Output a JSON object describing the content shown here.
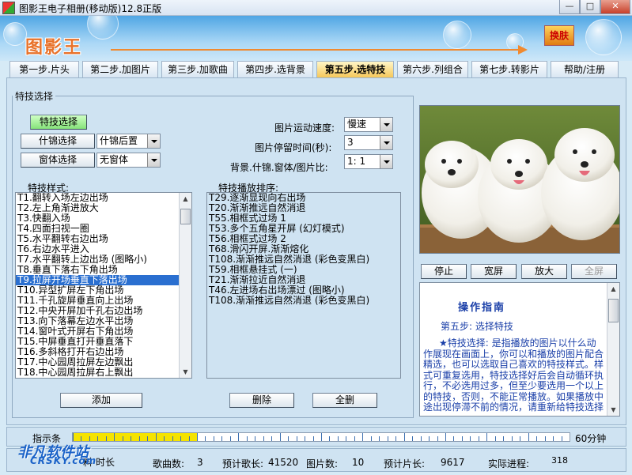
{
  "window": {
    "title": "图影王电子相册(移动版)12.8正版"
  },
  "banner": {
    "logo_text": "图影王",
    "skin_button": "换肤"
  },
  "tabs": [
    {
      "label": "第一步.片头"
    },
    {
      "label": "第二步.加图片"
    },
    {
      "label": "第三步.加歌曲"
    },
    {
      "label": "第四步.选背景"
    },
    {
      "label": "第五步.选特技"
    },
    {
      "label": "第六步.列组合"
    },
    {
      "label": "第七步.转影片"
    },
    {
      "label": "帮助/注册"
    }
  ],
  "effects_group": {
    "legend": "特技选择",
    "effect_select_button": "特技选择",
    "brocade_select_button": "什锦选择",
    "brocade_combo_value": "什锦后置",
    "window_select_button": "窗体选择",
    "window_combo_value": "无窗体",
    "speed_label": "图片运动速度:",
    "speed_value": "慢速",
    "pause_label": "图片停留时间(秒):",
    "pause_value": "3",
    "ratio_label": "背景.什锦.窗体/图片比:",
    "ratio_value": "1: 1",
    "styles_label": "特技样式:",
    "order_label": "特技播放排序:",
    "styles": [
      "T1.翻转入场左边出场",
      "T2.左上角渐进放大",
      "T3.快翻入场",
      "T4.四面扫视一圈",
      "T5.水平翻转右边出场",
      "T6.右边水平进入",
      "T7.水平翻转上边出场     (图略小)",
      "T8.垂直下落右下角出场",
      "T9.拉屏开场垂直下落出场",
      "T10.异型扩屏左下角出场",
      "T11.千孔旋屏垂直向上出场",
      "T12.中央开屏加千孔右边出场",
      "T13.向下落幕左边水平出场",
      "T14.窗叶式开屏右下角出场",
      "T15.中屏垂直打开垂直落下",
      "T16.多斜格打开右边出场",
      "T17.中心园周拉屏左边飘出",
      "T18.中心园周拉屏右上飘出"
    ],
    "selected_style_index": 8,
    "order": [
      "T29.逐渐显现向右出场",
      "T20.渐渐推远自然消退",
      "T55.相框式过场 1",
      "T53.多个五角星开屏   (幻灯模式)",
      "T56.相框式过场 2",
      "T68.滑闪开屏.渐渐熔化",
      "T108.渐渐推远自然消退     (彩色变黑白)",
      "T59.相框悬挂式 (一)",
      "T21.渐渐拉近自然消退",
      "T46.左进场右出场漂过       (图略小)",
      "T108.渐渐推远自然消退     (彩色变黑白)"
    ],
    "add_button": "添加",
    "delete_button": "删除",
    "delete_all_button": "全删"
  },
  "preview": {
    "stop_button": "停止",
    "wide_button": "宽屏",
    "zoom_button": "放大",
    "fullscreen_button": "全屏"
  },
  "guide": {
    "title": "操作指南",
    "step": "第五步: 选择特技",
    "body": "★特技选择: 是指播放的图片以什么动作展现在画面上，你可以和播放的图片配合精选，也可以选取自己喜欢的特技样式。样式可重复选用，特技选择好后会自动循环执行，不必选用过多，但至少要选用一个以上的特技，否则，不能正常播放。如果播放中途出现停滞不前的情况，请重新给特技选择"
  },
  "status": {
    "indicator_label": "指示条",
    "progress_fraction": 0.25,
    "duration_label": "60分钟",
    "song_count_label": "歌曲数:",
    "song_count_value": "3",
    "est_song_length_label": "预计歌长:",
    "est_song_length_value": "41520",
    "image_count_label": "图片数:",
    "image_count_value": "10",
    "est_film_length_label": "预计片长:",
    "est_film_length_value": "9617",
    "actual_progress_label": "实际进程:",
    "actual_progress_value": "318",
    "partial_left_label": "料",
    "partial_left_label2": "时长"
  },
  "watermark": {
    "line1": "非凡软件站",
    "line2": "CRSKY.com"
  }
}
